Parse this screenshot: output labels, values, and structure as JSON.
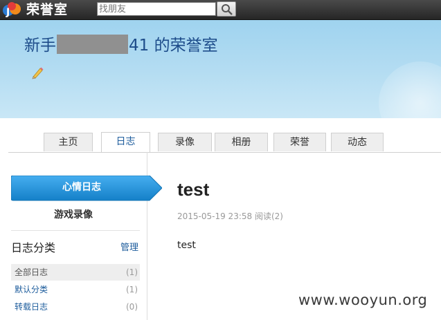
{
  "topbar": {
    "brand": "荣誉室",
    "search_placeholder": "找朋友"
  },
  "header": {
    "title_prefix": "新手",
    "title_suffix": "41 的荣誉室"
  },
  "tabs": [
    {
      "label": "主页"
    },
    {
      "label": "日志"
    },
    {
      "label": "录像"
    },
    {
      "label": "相册"
    },
    {
      "label": "荣誉"
    },
    {
      "label": "动态"
    }
  ],
  "active_tab": "日志",
  "sidebar": {
    "mood_log": "心情日志",
    "game_record": "游戏录像",
    "category_title": "日志分类",
    "manage": "管理",
    "categories": [
      {
        "name": "全部日志",
        "count": "(1)"
      },
      {
        "name": "默认分类",
        "count": "(1)"
      },
      {
        "name": "转载日志",
        "count": "(0)"
      }
    ]
  },
  "post": {
    "title": "test",
    "meta": "2015-05-19 23:58 阅读(2)",
    "body": "test"
  },
  "watermark": "www.wooyun.org",
  "colors": {
    "topbar": "#333333",
    "header_bg": "#b5ddf2",
    "title_text": "#1d4c8a",
    "mood_button": "#1e8fd8",
    "link": "#1d5c9c"
  }
}
